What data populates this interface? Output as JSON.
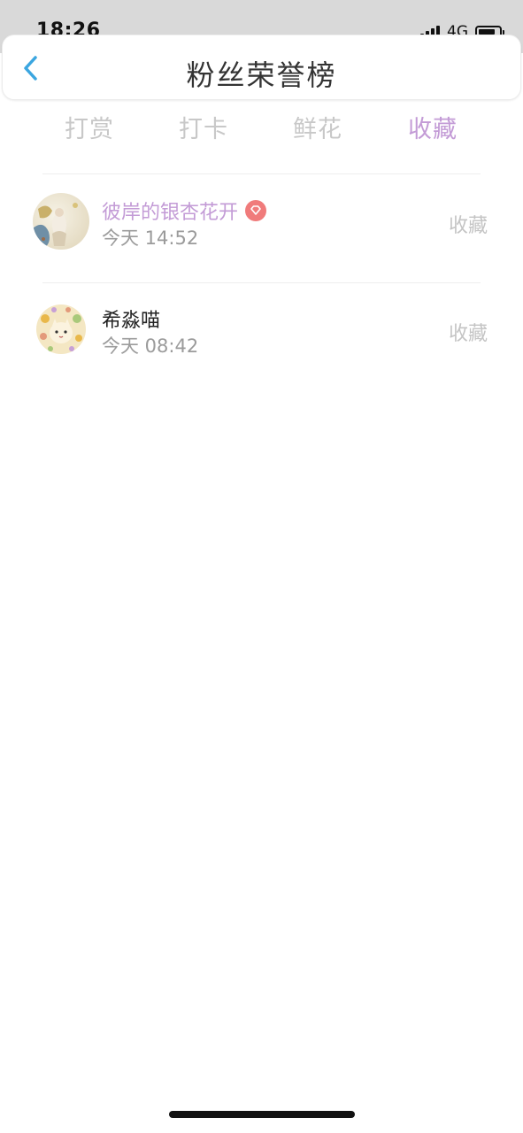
{
  "status_bar": {
    "time": "18:26",
    "network": "4G",
    "battery_level": 0.8
  },
  "header": {
    "back_icon": "chevron-left-icon",
    "title": "粉丝荣誉榜"
  },
  "tabs": [
    {
      "label": "打赏",
      "active": false
    },
    {
      "label": "打卡",
      "active": false
    },
    {
      "label": "鲜花",
      "active": false
    },
    {
      "label": "收藏",
      "active": true
    }
  ],
  "list": [
    {
      "name": "彼岸的银杏花开",
      "name_color": "#c39bd6",
      "badge_icon": "vip-diamond-icon",
      "time": "今天 14:52",
      "action": "收藏"
    },
    {
      "name": "希淼喵",
      "name_color": "#222222",
      "time": "今天 08:42",
      "action": "收藏"
    }
  ],
  "colors": {
    "accent": "#c39bd6",
    "back_arrow": "#3ba6e0",
    "badge": "#f07b7b",
    "muted": "#c4c4c4"
  }
}
